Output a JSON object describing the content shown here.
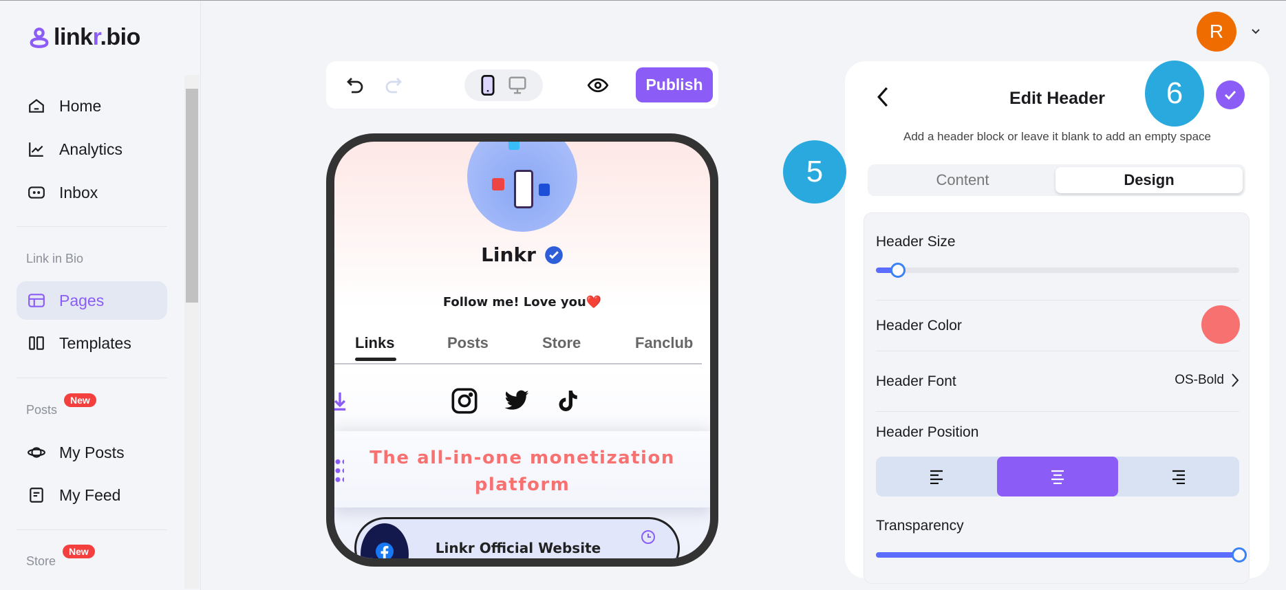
{
  "brand": {
    "logo_prefix": "link",
    "logo_accent": "r",
    "logo_suffix": ".bio",
    "accent_color": "#8b5cf6"
  },
  "sidebar": {
    "items": [
      {
        "label": "Home",
        "icon": "home-icon"
      },
      {
        "label": "Analytics",
        "icon": "chart-line-icon"
      },
      {
        "label": "Inbox",
        "icon": "inbox-icon"
      }
    ],
    "link_in_bio": {
      "title": "Link in Bio",
      "items": [
        {
          "label": "Pages",
          "icon": "layout-icon",
          "active": true
        },
        {
          "label": "Templates",
          "icon": "columns-icon"
        }
      ]
    },
    "posts": {
      "title": "Posts",
      "badge": "New",
      "items": [
        {
          "label": "My Posts",
          "icon": "planet-icon"
        },
        {
          "label": "My Feed",
          "icon": "feed-icon"
        }
      ]
    },
    "store": {
      "title": "Store",
      "badge": "New"
    }
  },
  "user": {
    "avatar_initial": "R",
    "avatar_color": "#ef6c00"
  },
  "toolbar": {
    "publish_label": "Publish",
    "device": "mobile"
  },
  "preview": {
    "name": "Linkr",
    "bio": "Follow me! Love you❤️",
    "tabs": [
      "Links",
      "Posts",
      "Store",
      "Fanclub"
    ],
    "active_tab": "Links",
    "socials": [
      "instagram",
      "twitter",
      "tiktok"
    ],
    "header_text_line1": "The all-in-one monetization",
    "header_text_line2": "platform",
    "link_title": "Linkr Official Website"
  },
  "panel": {
    "title": "Edit Header",
    "subtitle": "Add a header block or leave it blank to add an empty space",
    "tabs": [
      "Content",
      "Design"
    ],
    "active_tab": "Design",
    "header_size_label": "Header Size",
    "header_size_percent": 6,
    "header_color_label": "Header Color",
    "header_color": "#f87171",
    "header_font_label": "Header Font",
    "header_font_value": "OS-Bold",
    "header_position_label": "Header Position",
    "header_position": "center",
    "transparency_label": "Transparency",
    "transparency_percent": 100
  },
  "annotations": {
    "step5": "5",
    "step6": "6"
  }
}
